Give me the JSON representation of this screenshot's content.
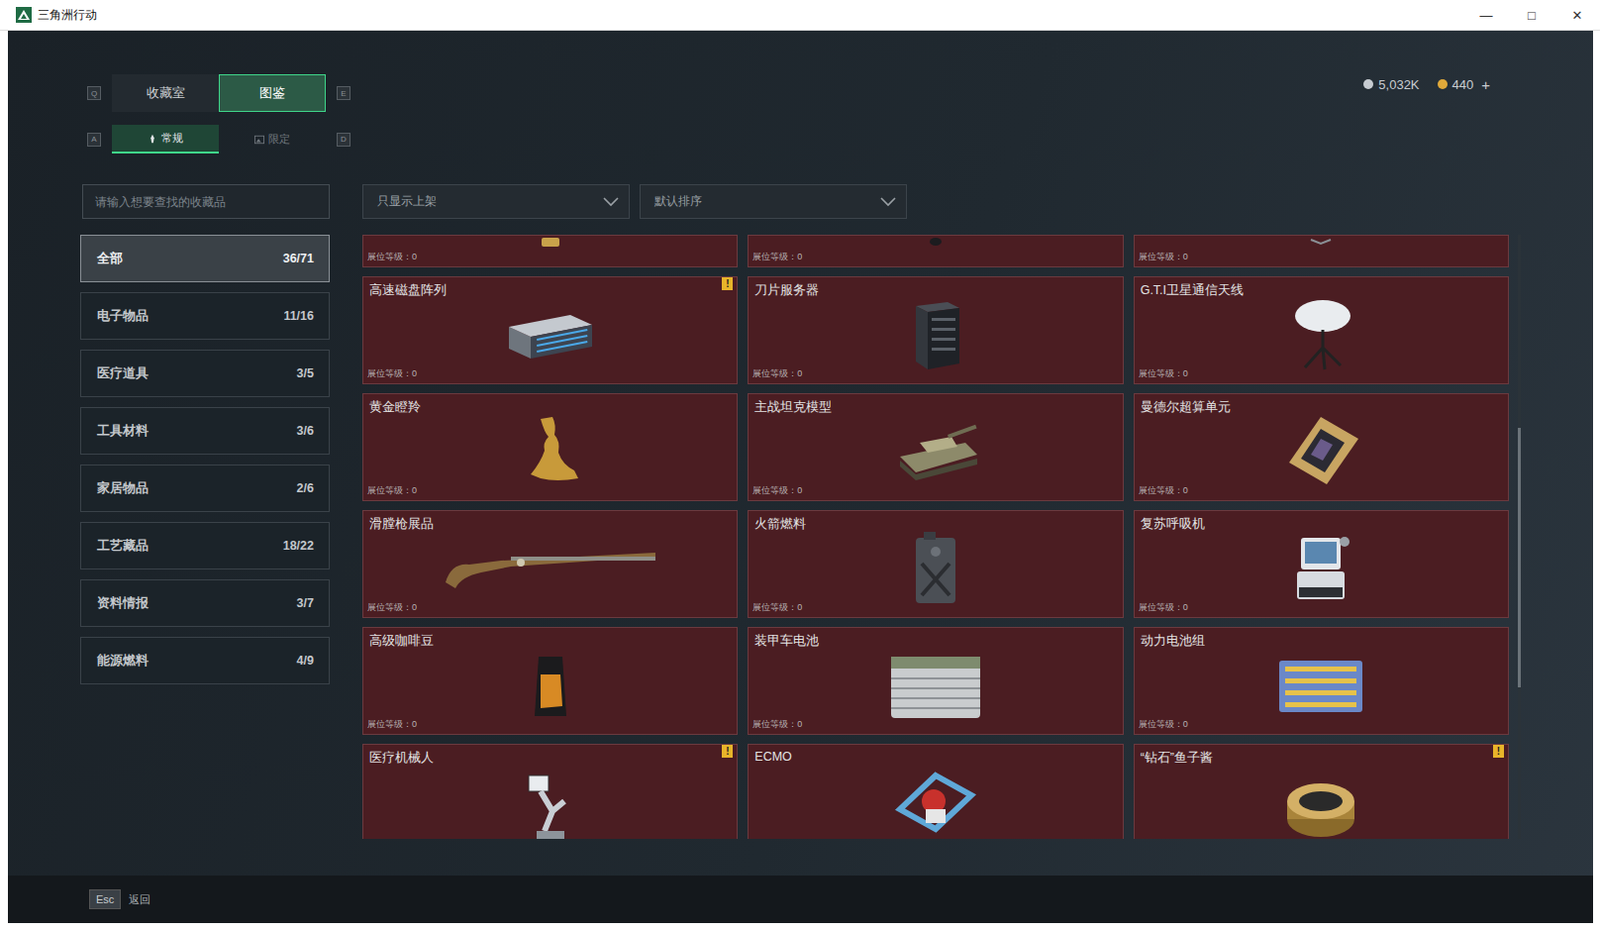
{
  "window": {
    "title": "三角洲行动",
    "controls": [
      "—",
      "□",
      "✕"
    ]
  },
  "currency": [
    {
      "value": "5,032K",
      "color": "#c7ccd2"
    },
    {
      "value": "440",
      "color": "#e0a93a"
    }
  ],
  "currency_add": "+",
  "top_tabs": {
    "prev_key": "Q",
    "next_key": "E",
    "tabs": [
      {
        "label": "收藏室",
        "selected": false
      },
      {
        "label": "图鉴",
        "selected": true
      }
    ]
  },
  "sub_tabs": {
    "prev_key": "A",
    "next_key": "D",
    "tabs": [
      {
        "label": "常规",
        "selected": true
      },
      {
        "label": "限定",
        "selected": false
      }
    ]
  },
  "search": {
    "placeholder": "请输入想要查找的收藏品"
  },
  "filters": [
    {
      "value": "只显示上架"
    },
    {
      "value": "默认排序"
    }
  ],
  "sidebar": {
    "items": [
      {
        "label": "全部",
        "count": "36/71",
        "selected": true
      },
      {
        "label": "电子物品",
        "count": "11/16",
        "selected": false
      },
      {
        "label": "医疗道具",
        "count": "3/5",
        "selected": false
      },
      {
        "label": "工具材料",
        "count": "3/6",
        "selected": false
      },
      {
        "label": "家居物品",
        "count": "2/6",
        "selected": false
      },
      {
        "label": "工艺藏品",
        "count": "18/22",
        "selected": false
      },
      {
        "label": "资料情报",
        "count": "3/7",
        "selected": false
      },
      {
        "label": "能源燃料",
        "count": "4/9",
        "selected": false
      }
    ]
  },
  "grid": {
    "alert_mark": "!",
    "scrollbar": {
      "offset": 0.32,
      "size": 0.43
    },
    "cards": [
      {
        "kind": "partial",
        "level_text": "展位等级：0",
        "alert": false
      },
      {
        "kind": "partial",
        "level_text": "展位等级：0",
        "alert": false
      },
      {
        "kind": "partial",
        "level_text": "展位等级：0",
        "alert": false
      },
      {
        "kind": "full",
        "name": "高速磁盘阵列",
        "level_text": "展位等级：0",
        "alert": true
      },
      {
        "kind": "full",
        "name": "刀片服务器",
        "level_text": "展位等级：0",
        "alert": false
      },
      {
        "kind": "full",
        "name": "G.T.I卫星通信天线",
        "level_text": "展位等级：0",
        "alert": false
      },
      {
        "kind": "full",
        "name": "黄金瞪羚",
        "level_text": "展位等级：0",
        "alert": false
      },
      {
        "kind": "full",
        "name": "主战坦克模型",
        "level_text": "展位等级：0",
        "alert": false
      },
      {
        "kind": "full",
        "name": "曼德尔超算单元",
        "level_text": "展位等级：0",
        "alert": false
      },
      {
        "kind": "full",
        "name": "滑膛枪展品",
        "level_text": "展位等级：0",
        "alert": false
      },
      {
        "kind": "full",
        "name": "火箭燃料",
        "level_text": "展位等级：0",
        "alert": false
      },
      {
        "kind": "full",
        "name": "复苏呼吸机",
        "level_text": "展位等级：0",
        "alert": false
      },
      {
        "kind": "full",
        "name": "高级咖啡豆",
        "level_text": "展位等级：0",
        "alert": false
      },
      {
        "kind": "full",
        "name": "装甲车电池",
        "level_text": "展位等级：0",
        "alert": false
      },
      {
        "kind": "full",
        "name": "动力电池组",
        "level_text": "展位等级：0",
        "alert": false
      },
      {
        "kind": "cut",
        "name": "医疗机械人",
        "alert": true
      },
      {
        "kind": "cut",
        "name": "ECMO",
        "alert": false
      },
      {
        "kind": "cut",
        "name": "“钻石”鱼子酱",
        "alert": true
      }
    ]
  },
  "footer": {
    "key": "Esc",
    "label": "返回"
  }
}
